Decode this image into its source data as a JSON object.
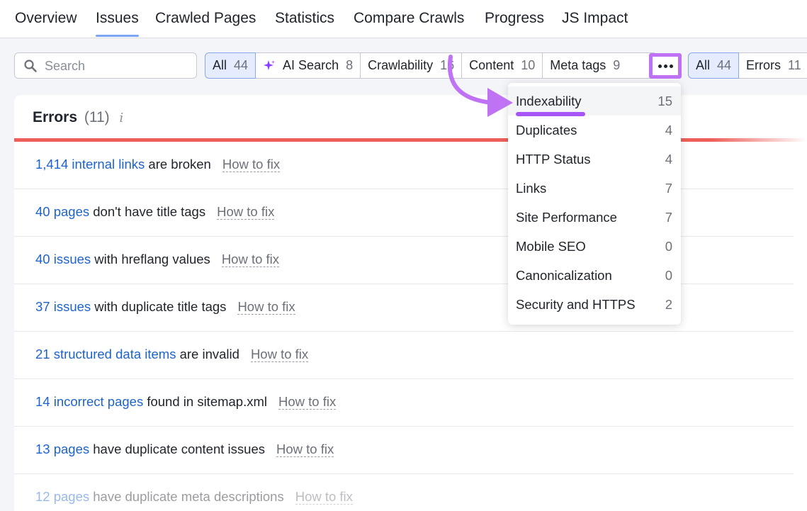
{
  "nav": {
    "tabs": [
      {
        "label": "Overview"
      },
      {
        "label": "Issues",
        "active": true
      },
      {
        "label": "Crawled Pages"
      },
      {
        "label": "Statistics"
      },
      {
        "label": "Compare Crawls"
      },
      {
        "label": "Progress"
      },
      {
        "label": "JS Impact"
      }
    ]
  },
  "search": {
    "placeholder": "Search",
    "icon": "search-icon"
  },
  "filters": {
    "all": {
      "label": "All",
      "count": "44"
    },
    "ai_search": {
      "label": "AI Search",
      "count": "8",
      "icon": "sparkle-icon"
    },
    "crawlability": {
      "label": "Crawlability",
      "count": "16"
    },
    "content": {
      "label": "Content",
      "count": "10"
    },
    "meta_tags": {
      "label": "Meta tags",
      "count": "9"
    },
    "more_icon": "more-horizontal-icon"
  },
  "severity": {
    "all": {
      "label": "All",
      "count": "44"
    },
    "errors": {
      "label": "Errors",
      "count": "11"
    }
  },
  "errors_card": {
    "title": "Errors",
    "count": "(11)",
    "info_icon": "info-icon",
    "info_glyph": "i",
    "rows": [
      {
        "link": "1,414 internal links",
        "text": " are broken",
        "fix": "How to fix"
      },
      {
        "link": "40 pages",
        "text": " don't have title tags",
        "fix": "How to fix"
      },
      {
        "link": "40 issues",
        "text": " with hreflang values",
        "fix": "How to fix"
      },
      {
        "link": "37 issues",
        "text": " with duplicate title tags",
        "fix": "How to fix"
      },
      {
        "link": "21 structured data items",
        "text": " are invalid",
        "fix": "How to fix"
      },
      {
        "link": "14 incorrect pages",
        "text": " found in sitemap.xml",
        "fix": "How to fix"
      },
      {
        "link": "13 pages",
        "text": " have duplicate content issues",
        "fix": "How to fix"
      },
      {
        "link": "12 pages",
        "text": " have duplicate meta descriptions",
        "fix": "How to fix"
      }
    ]
  },
  "dropdown": {
    "items": [
      {
        "label": "Indexability",
        "count": "15"
      },
      {
        "label": "Duplicates",
        "count": "4"
      },
      {
        "label": "HTTP Status",
        "count": "4"
      },
      {
        "label": "Links",
        "count": "7"
      },
      {
        "label": "Site Performance",
        "count": "7"
      },
      {
        "label": "Mobile SEO",
        "count": "0"
      },
      {
        "label": "Canonicalization",
        "count": "0"
      },
      {
        "label": "Security and HTTPS",
        "count": "2"
      }
    ]
  },
  "colors": {
    "accent": "#bf73f4",
    "link": "#1d63cf",
    "error": "#ee5f5a",
    "active_tab": "#7ea4f5"
  }
}
